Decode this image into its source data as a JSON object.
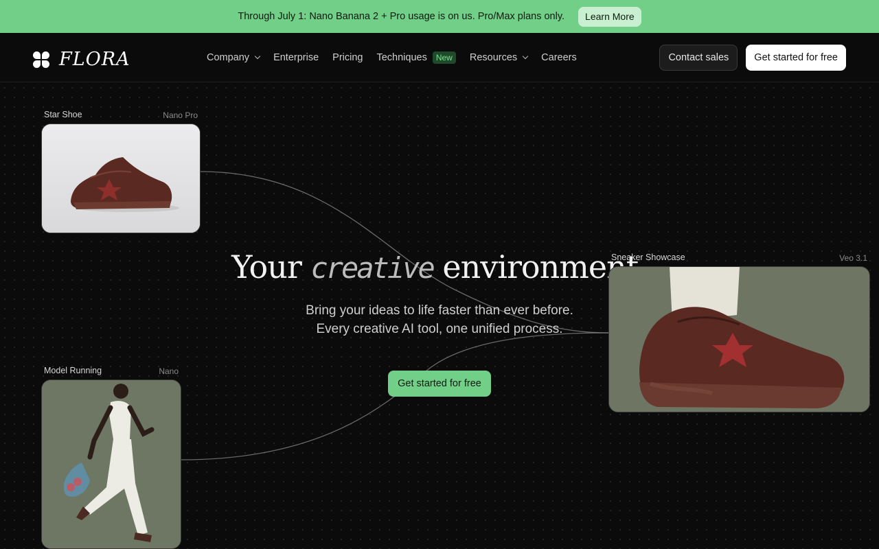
{
  "banner": {
    "text": "Through July 1: Nano Banana 2 + Pro usage is on us. Pro/Max plans only.",
    "button": "Learn More"
  },
  "nav": {
    "logo_text": "FLORA",
    "items": [
      {
        "label": "Company",
        "dropdown": true
      },
      {
        "label": "Enterprise"
      },
      {
        "label": "Pricing"
      },
      {
        "label": "Techniques",
        "badge": "New"
      },
      {
        "label": "Resources",
        "dropdown": true
      },
      {
        "label": "Careers"
      }
    ],
    "contact": "Contact sales",
    "start": "Get started for free"
  },
  "hero": {
    "title_before": "Your",
    "title_italic": "creative",
    "title_after": "environment.",
    "sub_line1": "Bring your ideas to life faster than ever before.",
    "sub_line2": "Every creative AI tool, one unified process.",
    "button": "Get started for free"
  },
  "cards": [
    {
      "label": "Star Shoe",
      "model": "Nano Pro"
    },
    {
      "label": "Model Running",
      "model": "Nano"
    },
    {
      "label": "Sneaker Showcase",
      "model": "Veo 3.1"
    }
  ],
  "colors": {
    "accent": "#72cf88",
    "background": "#0b0b0b",
    "shoe_brown": "#5a2a22",
    "photo_olive": "#6e7763"
  }
}
